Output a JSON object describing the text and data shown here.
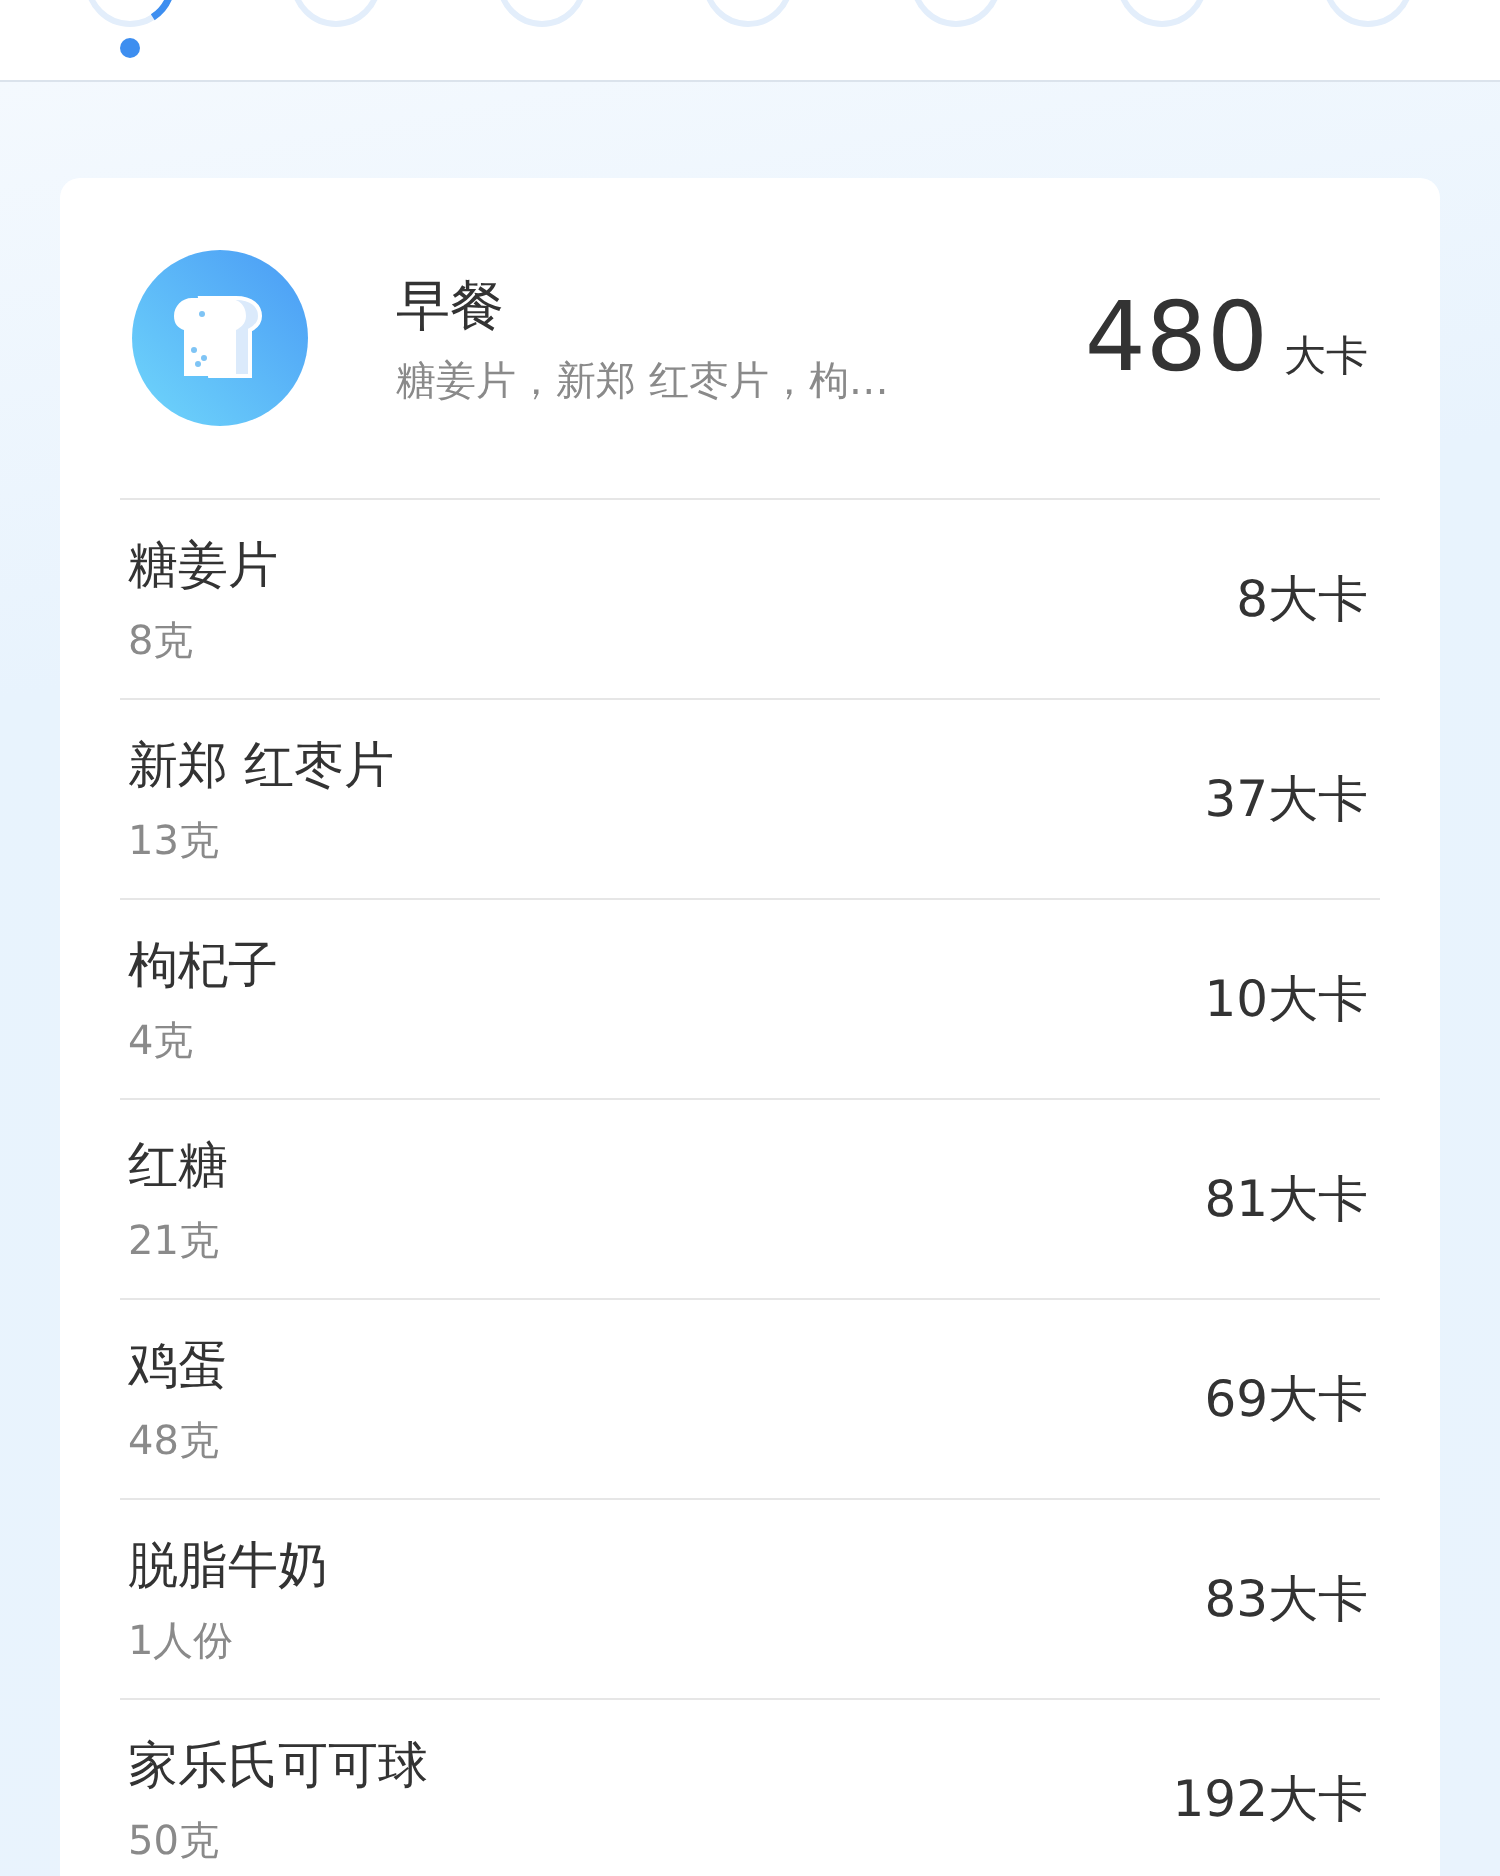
{
  "days": [
    {
      "selected": true
    },
    {
      "selected": false
    },
    {
      "selected": false
    },
    {
      "selected": false
    },
    {
      "selected": false
    },
    {
      "selected": false
    },
    {
      "selected": false
    }
  ],
  "meal": {
    "title": "早餐",
    "summary": "糖姜片，新郑 红枣片，枸…",
    "calories": "480",
    "unit": "大卡"
  },
  "foods": [
    {
      "name": "糖姜片",
      "amount": "8克",
      "calories": "8大卡"
    },
    {
      "name": "新郑 红枣片",
      "amount": "13克",
      "calories": "37大卡"
    },
    {
      "name": "枸杞子",
      "amount": "4克",
      "calories": "10大卡"
    },
    {
      "name": "红糖",
      "amount": "21克",
      "calories": "81大卡"
    },
    {
      "name": "鸡蛋",
      "amount": "48克",
      "calories": "69大卡"
    },
    {
      "name": "脱脂牛奶",
      "amount": "1人份",
      "calories": "83大卡"
    },
    {
      "name": "家乐氏可可球",
      "amount": "50克",
      "calories": "192大卡"
    }
  ]
}
